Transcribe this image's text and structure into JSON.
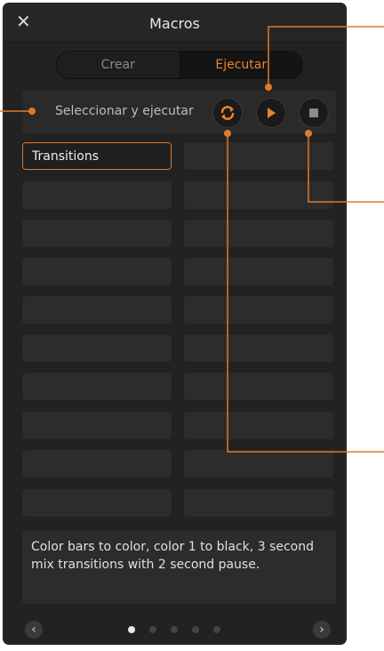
{
  "window": {
    "title": "Macros",
    "close_symbol": "✕"
  },
  "tabs": [
    {
      "label": "Crear",
      "selected": false
    },
    {
      "label": "Ejecutar",
      "selected": true
    }
  ],
  "run_bar": {
    "label": "Seleccionar y ejecutar",
    "buttons": [
      {
        "icon": "loop-icon"
      },
      {
        "icon": "play-icon"
      },
      {
        "icon": "stop-icon"
      }
    ]
  },
  "macro_slots": {
    "columns": 2,
    "rows": 10,
    "items": [
      {
        "label": "Transitions",
        "selected": true
      }
    ]
  },
  "description": "Color bars to color, color 1 to black, 3 second mix transitions with 2 second pause.",
  "pagination": {
    "pages": 5,
    "current": 1,
    "prev_symbol": "‹",
    "next_symbol": "›"
  },
  "colors": {
    "accent": "#e8832e",
    "panel": "#222222",
    "slot": "#2c2c2c"
  }
}
